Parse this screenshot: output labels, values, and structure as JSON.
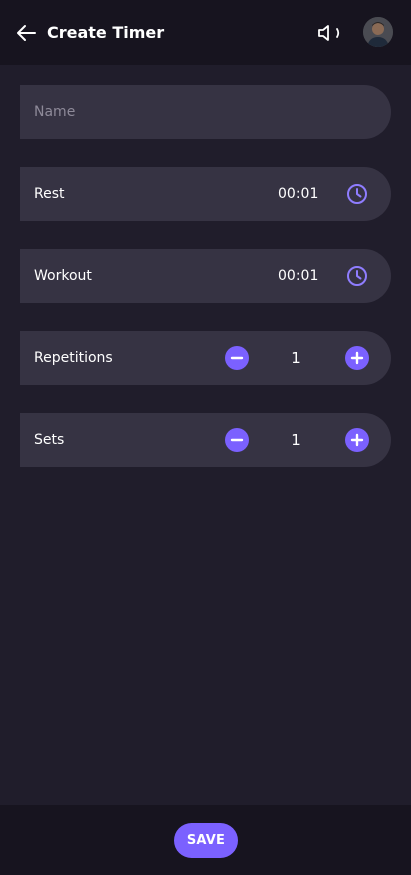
{
  "appbar": {
    "title": "Create Timer",
    "back_icon": "arrow-left-icon",
    "sound_icon": "speaker-icon",
    "avatar_icon": "user-avatar"
  },
  "form": {
    "name": {
      "placeholder": "Name",
      "value": ""
    },
    "rest": {
      "label": "Rest",
      "value": "00:01",
      "icon": "clock-icon"
    },
    "workout": {
      "label": "Workout",
      "value": "00:01",
      "icon": "clock-icon"
    },
    "repetitions": {
      "label": "Repetitions",
      "value": "1"
    },
    "sets": {
      "label": "Sets",
      "value": "1"
    }
  },
  "footer": {
    "save_label": "SAVE"
  },
  "colors": {
    "background": "#201d2b",
    "bar": "#17141f",
    "field": "#363343",
    "accent": "#7b61ff",
    "placeholder": "#8e8a99"
  }
}
